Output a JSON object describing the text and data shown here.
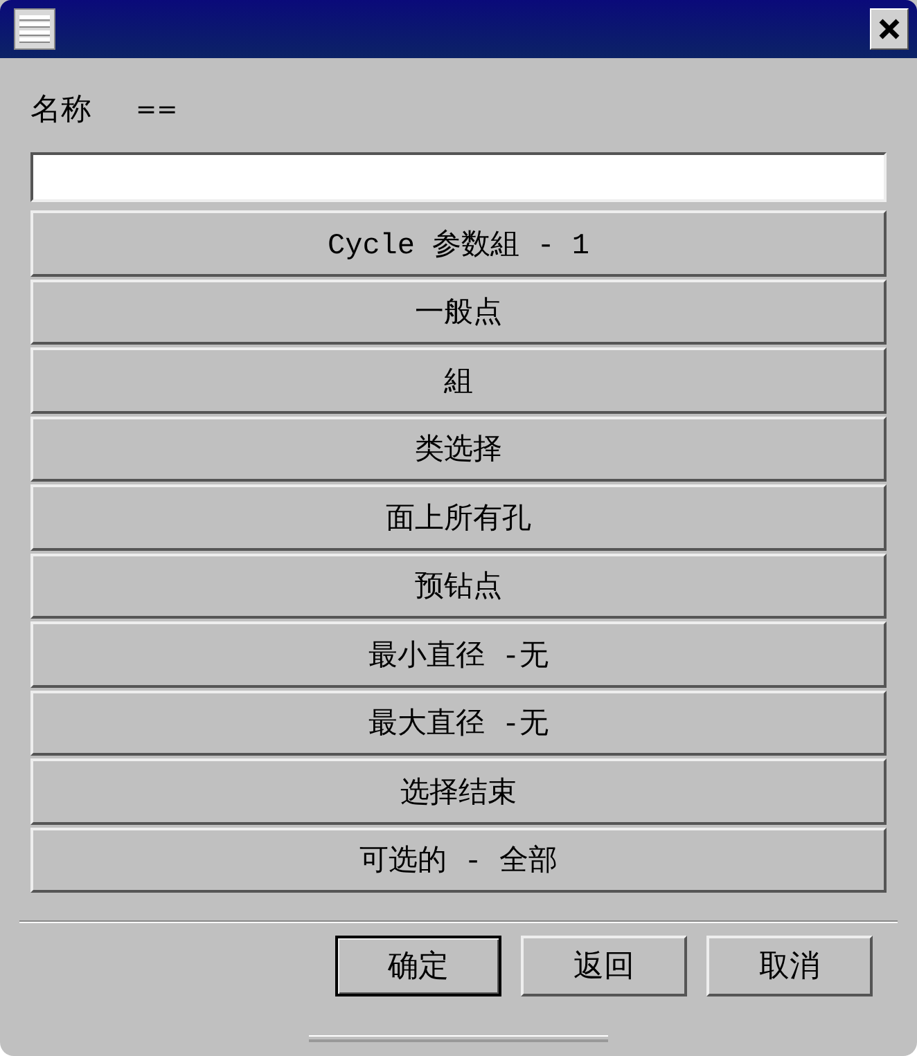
{
  "name_label": "名称",
  "name_value": "==",
  "options": [
    {
      "label": "Cycle 参数組 - 1"
    },
    {
      "label": "一般点"
    },
    {
      "label": "組"
    },
    {
      "label": "类选择"
    },
    {
      "label": "面上所有孔"
    },
    {
      "label": "预钻点"
    },
    {
      "label": "最小直径 -无"
    },
    {
      "label": "最大直径 -无"
    },
    {
      "label": "选择结束"
    },
    {
      "label": "可选的 - 全部"
    }
  ],
  "buttons": [
    {
      "label": "确定",
      "default": true
    },
    {
      "label": "返回",
      "default": false
    },
    {
      "label": "取消",
      "default": false
    }
  ]
}
